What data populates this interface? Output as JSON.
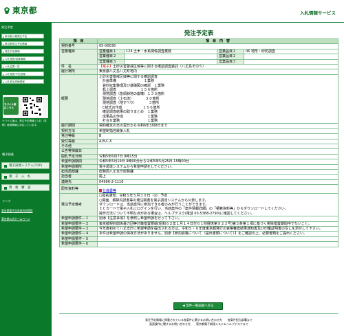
{
  "header": {
    "logo_text": "東京都",
    "service_title": "入札情報サービス"
  },
  "sidebar": {
    "section1_label": "発注予定",
    "items": [
      "東京都公報発注予定",
      "東京都発注予定情報",
      "発注予定情報",
      "入札見積/結果情報",
      "入札結果一覧",
      "入札見積/予定価格",
      "入札参加資格情報"
    ],
    "mobile_label": "モバイル版はこちら",
    "mobile_note": "モバイル版は、発注予定情報と入札（見積）経過情報に対応しています。",
    "section2_label": "電子調達",
    "big_buttons": [
      "電子調達システム(TOP)",
      "電　子　入　札",
      "資　格　審　査"
    ],
    "section3_label": "リンク",
    "links": [
      "東京都電子自治体共同運営",
      "東京都公式ホームページ"
    ]
  },
  "main": {
    "page_title": "発注予定表",
    "col_item": "項　目",
    "col_content": "項　目　内　容",
    "contract_no_label": "契約番号",
    "contract_no": "05-00038",
    "biz_type_label": "営業種目",
    "biz_sub1": "営業種目１",
    "biz_val1": "124 土木・水系関係調査業務",
    "biz_sub2": "営業種目２",
    "biz_sub3": "営業種目３",
    "product_sub1": "営業品目１",
    "product_val1": "06 地形・砂防調査",
    "product_sub2": "営業品目２",
    "product_sub3": "営業品目３",
    "name_label": "件　名",
    "name_tag": "【電子】",
    "name_value": "土砂災害警戒区域等に関する確認調査委託（八丈島その５）",
    "location_label": "履行場所",
    "location_value": "東京都八丈島八丈町地内",
    "summary_label": "概要",
    "summary_value": "土砂災害警戒区域等に関する確認調査\n　計画準備　　　　　　　　１業務\n　資料収集整理及び基礎図の確認　１業務\n　机上調査　　　　　　　１５６箇所\n　現地調査（急傾斜地の崩壊）１３５箇所\n　現地調査（土石流）　　　　２０箇所\n　現地調査（地すべり）　　　　３箇所\n　C様式の作成　　　　　　１５６箇所\n　確認調査結果の取りまとめ　１業務\n　成果品の作成　　　　　　　１業務\n　打合せ業務　　　　　　　　１業務",
    "period_label": "履行期間",
    "period_value": "契約確定の日の翌日から令和6年3月8日まで",
    "method_label": "契約方法",
    "method_value": "希望制指名競争入札",
    "rank_label": "発注等級",
    "rank_value": "B",
    "accept_label": "受付等級",
    "accept_value": "A,B,C,X",
    "other_label": "その他",
    "ticket_label": "公告等掲載日",
    "ticket_value": "",
    "open_label": "開札予定日時",
    "open_value": "令和5年6月7日 9時15分",
    "apply_label": "希望申請期間",
    "apply_value": "令和5年5月19日 9時00分から令和5年5月25日 15時00分",
    "apply_no_label": "希望申請場所",
    "apply_no_value": "電子調達システムから希望申請をしてください。",
    "office_label": "担当局部課",
    "office_value": "総務局八丈支庁総務課",
    "person_label": "担当者",
    "person_value": "尾上",
    "phone_label": "連絡先",
    "phone_value": "04996-2-1116",
    "doc_label": "配布資料等",
    "doc_link": "仕様書等",
    "notes_label": "発注予定備考",
    "notes_value": "○指名通知：令和５年５月３０日（火）予定\n○図面、積算内訳書等の発注図書を電子調達システムから公表します。\nダウンロードは、当該案件に参加できる者のみが行うことができます。\nＩＣカードで電子入札にログインを行い、当該案件の「案件情報詳細」の「積算資料等」からダウンロードしてください。\n操作方法について不明な点がある場合は、ヘルプデスク(電話 03-5388-2790)に確認してください。",
    "req1_label": "希望申請要件－１",
    "req1_value": "別添【注意事項】を参照し希望申請を行って下さい。",
    "req2_label": "希望申請要件－２",
    "req2_value": "東京都契約関係暴力団等対策措置要綱(昭和６２年１月１４日付６１財経庶第９２２号)第５条第１項に基づく排除措置期間中でないこと。",
    "req3_label": "希望申請要件－３",
    "req3_value": "今年度初めて八丈支庁に希望申請を提出される方は、令和５・６年度東京都発行の資格審査結果通知書及び印鑑証明書の写しを添付して下さい。",
    "req4_label": "希望申請要件－４",
    "req4_value": "本件は希望申請の保存方法がありません。別添【参加資格について（提出書類について）】をご確認の上、必要書類をご提出ください。",
    "req5_label": "希望申請要件－５",
    "req6_label": "希望申請要件－６",
    "back_button": "案件一覧画面へ戻る"
  },
  "footer": {
    "line1": "発注予定情報に掲載されている各案件に関するお問い合わせ先　　各案件担当部署まで",
    "line2": "画面操作に関するお問い合わせ先　　東京都電子調達システムヘルプデスクまで"
  },
  "colors": {
    "brand_green": "#0a7a2a",
    "label_bg": "#dff0df",
    "accent_red": "#cc0000"
  }
}
